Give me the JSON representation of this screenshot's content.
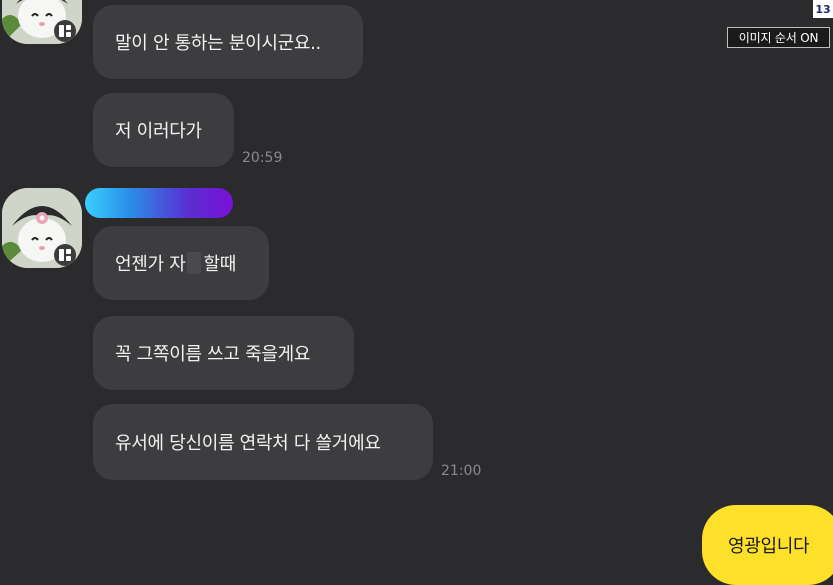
{
  "overlay": {
    "page_number": "13",
    "order_toggle_label": "이미지 순서 ON"
  },
  "messages": {
    "m1": "말이 안 통하는 분이시군요..",
    "m2": "저 이러다가",
    "t1": "20:59",
    "m3_before": "언젠가 자",
    "m3_after": "할때",
    "m4": "꼭 그쪽이름 쓰고 죽을게요",
    "m5": "유서에 당신이름 연락처 다 쓸거에요",
    "t2": "21:00",
    "mine": "영광입니다"
  },
  "colors": {
    "background": "#2b2b2d",
    "bubble": "#3d3d40",
    "my_bubble": "#fde02a",
    "name_gradient_start": "#3ad0ff",
    "name_gradient_end": "#7a10d8"
  },
  "icons": {
    "avatar": "kuromi-avatar",
    "badge": "badge-icon"
  }
}
